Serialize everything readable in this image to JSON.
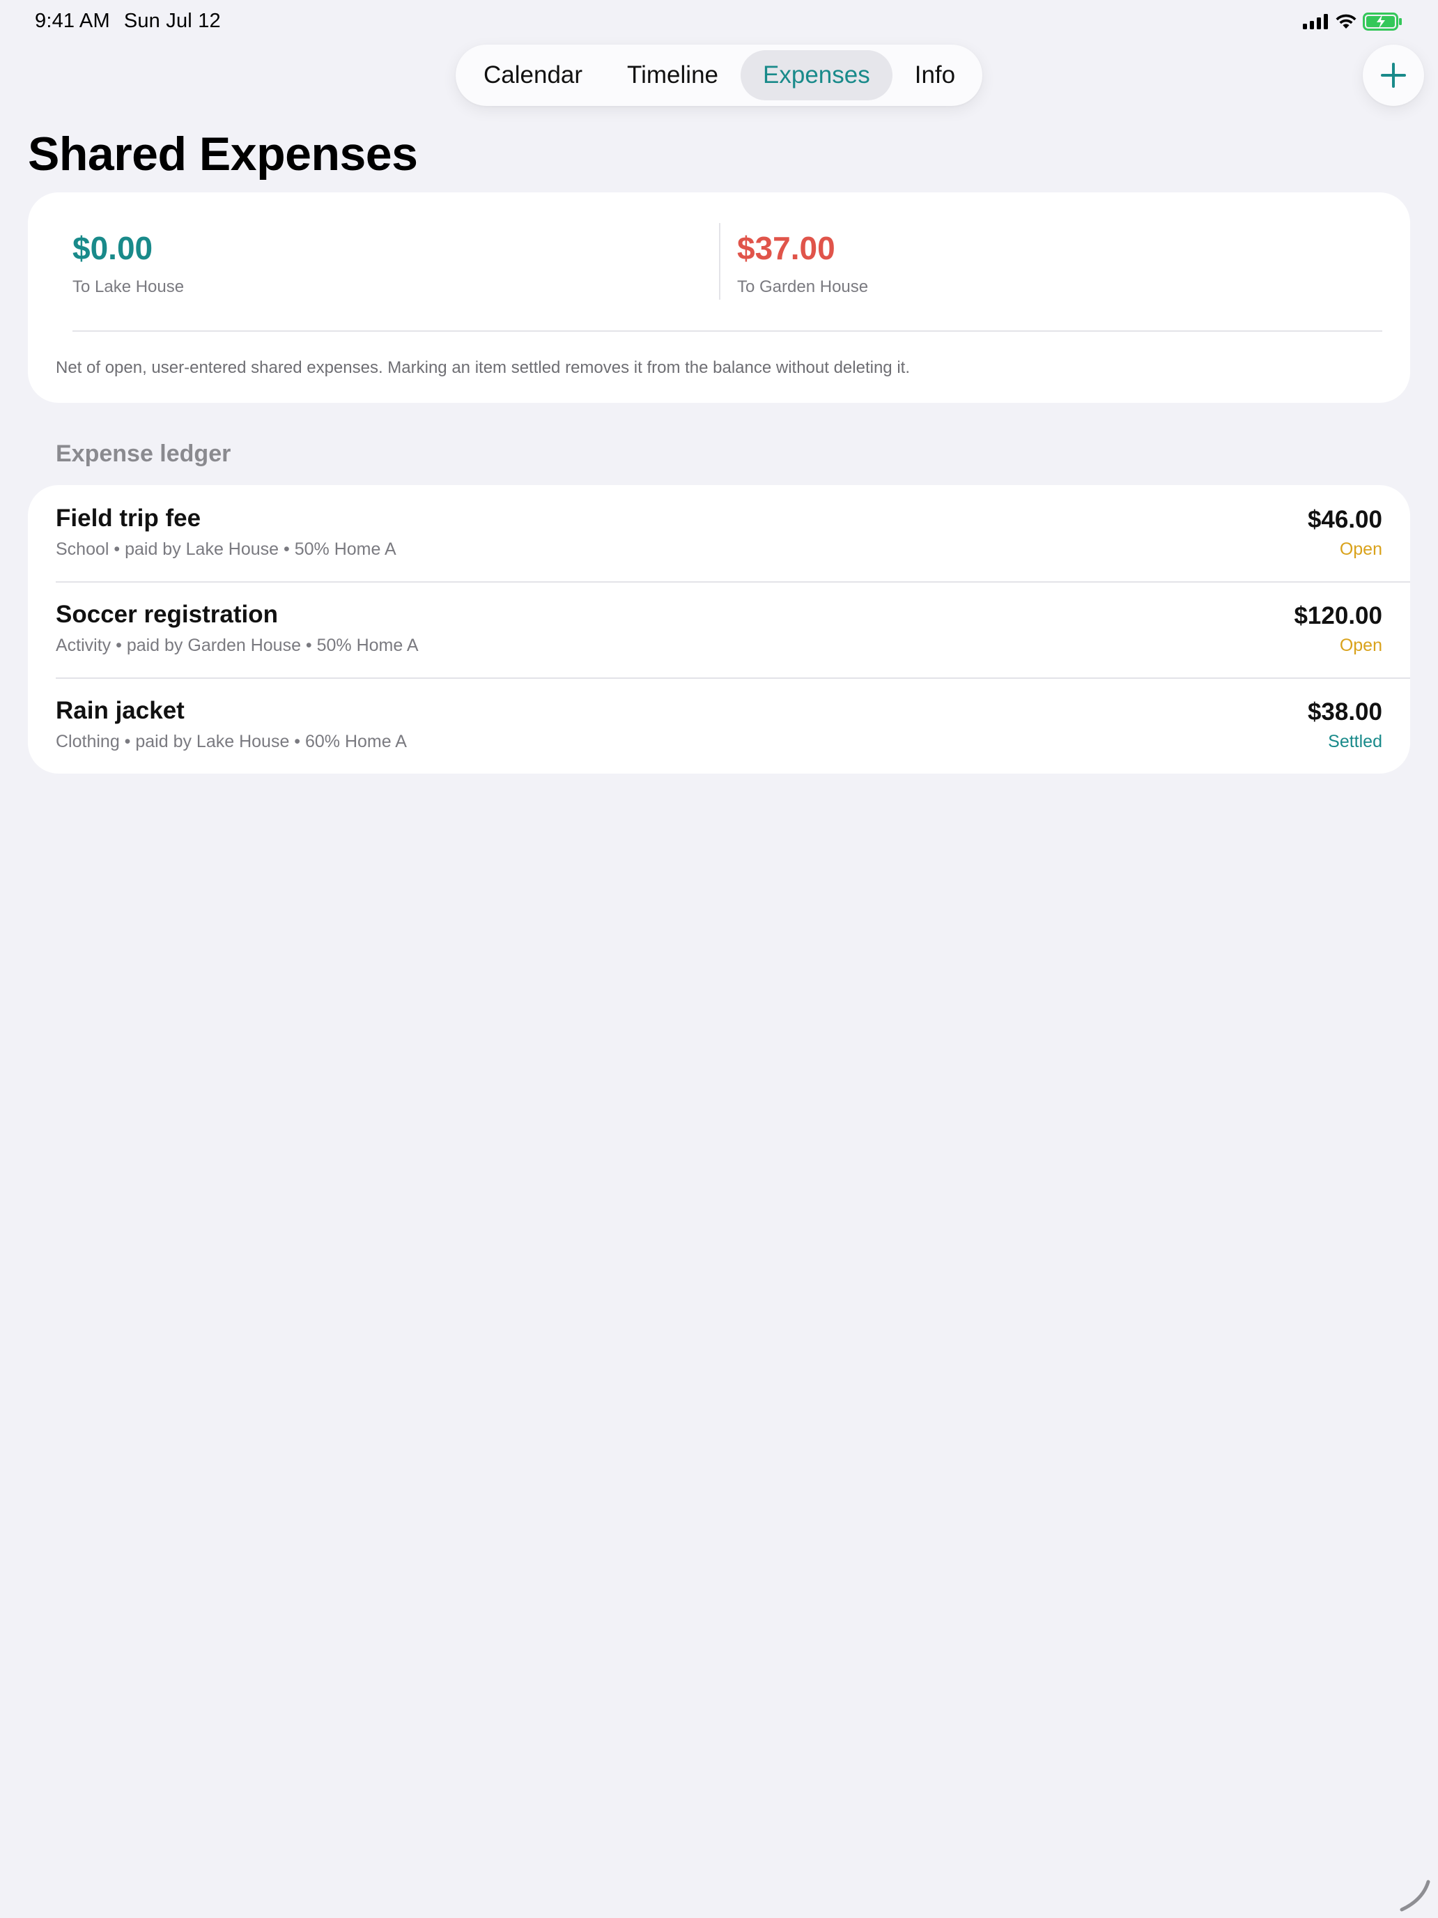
{
  "status_bar": {
    "time": "9:41 AM",
    "date": "Sun Jul 12"
  },
  "tabs": [
    {
      "label": "Calendar",
      "active": false
    },
    {
      "label": "Timeline",
      "active": false
    },
    {
      "label": "Expenses",
      "active": true
    },
    {
      "label": "Info",
      "active": false
    }
  ],
  "page": {
    "title": "Shared Expenses"
  },
  "balance": {
    "left": {
      "amount": "$0.00",
      "label": "To Lake House"
    },
    "right": {
      "amount": "$37.00",
      "label": "To Garden House"
    },
    "note": "Net of open, user-entered shared expenses. Marking an item settled removes it from the balance without deleting it."
  },
  "ledger": {
    "header": "Expense ledger",
    "items": [
      {
        "title": "Field trip fee",
        "subtitle": "School • paid by Lake House • 50% Home A",
        "amount": "$46.00",
        "status": "Open"
      },
      {
        "title": "Soccer registration",
        "subtitle": "Activity • paid by Garden House • 50% Home A",
        "amount": "$120.00",
        "status": "Open"
      },
      {
        "title": "Rain jacket",
        "subtitle": "Clothing • paid by Lake House • 60% Home A",
        "amount": "$38.00",
        "status": "Settled"
      }
    ]
  },
  "colors": {
    "accent": "#198a8a",
    "negative": "#e0544a",
    "open": "#d9a21b",
    "settled": "#198a8a",
    "background": "#f2f2f7"
  },
  "icons": {
    "add": "plus-icon",
    "signal": "cellular-signal-icon",
    "wifi": "wifi-icon",
    "battery": "battery-charging-icon"
  }
}
